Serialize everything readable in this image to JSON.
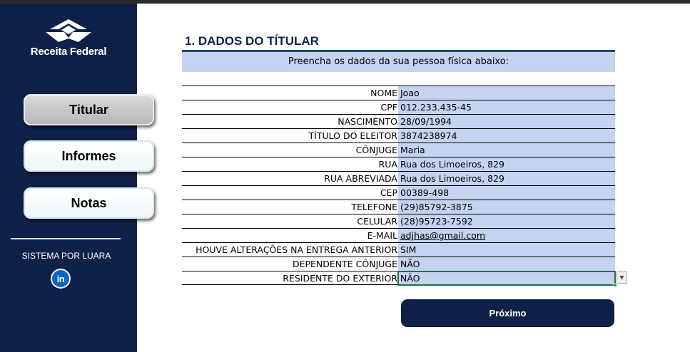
{
  "sidebar": {
    "logo_text": "Receita Federal",
    "nav": [
      {
        "label": "Titular",
        "active": true
      },
      {
        "label": "Informes",
        "active": false
      },
      {
        "label": "Notas",
        "active": false
      }
    ],
    "credit": "SISTEMA POR LUARA",
    "social_icon": "linkedin-icon",
    "social_label": "in"
  },
  "main": {
    "section_title": "1. DADOS DO TÍTULAR",
    "subtitle": "Preencha os dados da sua pessoa física abaixo:",
    "fields": [
      {
        "label": "NOME",
        "value": "Joao"
      },
      {
        "label": "CPF",
        "value": "012.233.435-45"
      },
      {
        "label": "NASCIMENTO",
        "value": "28/09/1994"
      },
      {
        "label": "TÍTULO DO ELEITOR",
        "value": "3874238974"
      },
      {
        "label": "CÔNJUGE",
        "value": "Maria"
      },
      {
        "label": "RUA",
        "value": "Rua dos Limoeiros, 829"
      },
      {
        "label": "RUA ABREVIADA",
        "value": "Rua dos Limoeiros, 829"
      },
      {
        "label": "CEP",
        "value": "00389-498"
      },
      {
        "label": "TELEFONE",
        "value": "(29)85792-3875"
      },
      {
        "label": "CELULAR",
        "value": "(28)95723-7592"
      },
      {
        "label": "E-MAIL",
        "value": "adjhas@gmail.com"
      },
      {
        "label": "HOUVE ALTERAÇÕES NA ENTREGA ANTERIOR",
        "value": "SIM"
      },
      {
        "label": "DEPENDENTE CÔNJUGE",
        "value": "NÃO"
      },
      {
        "label": "RESIDENTE DO EXTERIOR",
        "value": "NÃO"
      }
    ],
    "dropdown_icon": "chevron-down-icon",
    "next_label": "Próximo"
  },
  "colors": {
    "sidebar_bg": "#0e2249",
    "field_bg": "#c5d3f0",
    "title_color": "#0e2249",
    "selection": "#1e7145",
    "linkedin": "#0a66c2"
  }
}
